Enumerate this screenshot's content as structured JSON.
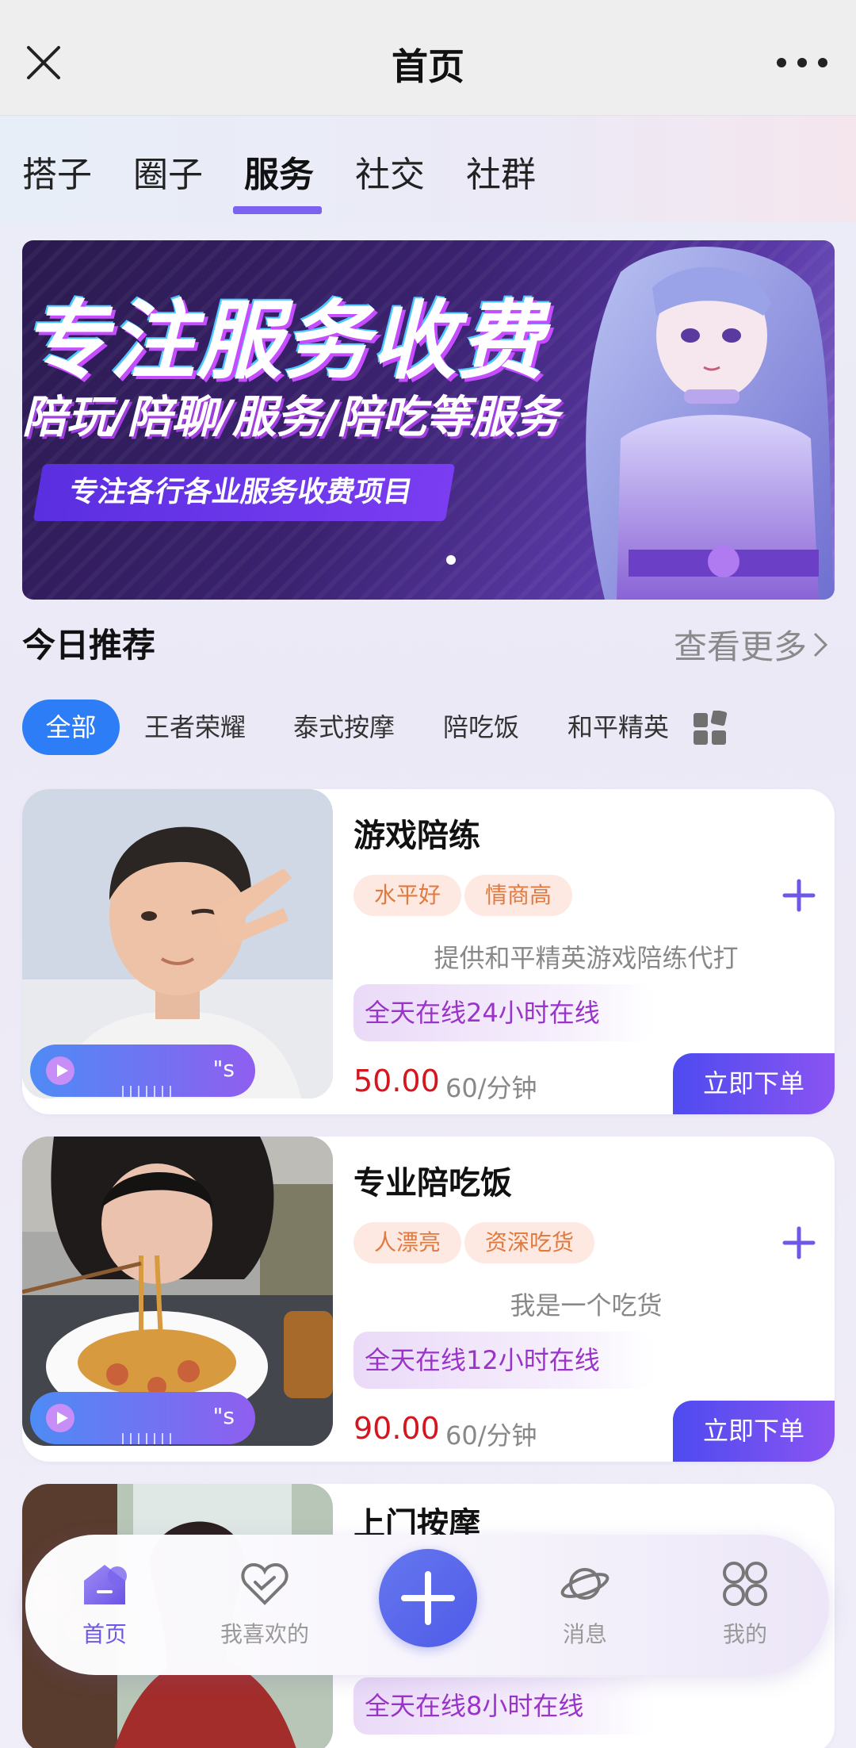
{
  "header": {
    "title": "首页",
    "close_icon": "close-icon",
    "more_icon": "more-dots-icon"
  },
  "tabs": [
    {
      "label": "搭子"
    },
    {
      "label": "圈子"
    },
    {
      "label": "服务",
      "active": true
    },
    {
      "label": "社交"
    },
    {
      "label": "社群"
    }
  ],
  "banner": {
    "headline": "专注服务收费",
    "subline": "陪玩/陪聊/服务/陪吃等服务",
    "tag": "专注各行各业服务收费项目",
    "slide_count": 1
  },
  "section": {
    "title": "今日推荐",
    "see_more": "查看更多"
  },
  "chips": [
    "全部",
    "王者荣耀",
    "泰式按摩",
    "陪吃饭",
    "和平精英"
  ],
  "active_chip": "全部",
  "cards": [
    {
      "title": "游戏陪练",
      "tags": [
        "水平好",
        "情商高"
      ],
      "description": "提供和平精英游戏陪练代打",
      "online": "全天在线24小时在线",
      "price": "50.00",
      "unit": "60/分钟",
      "order_label": "立即下单",
      "audio_label": "\"s"
    },
    {
      "title": "专业陪吃饭",
      "tags": [
        "人漂亮",
        "资深吃货"
      ],
      "description": "我是一个吃货",
      "online": "全天在线12小时在线",
      "price": "90.00",
      "unit": "60/分钟",
      "order_label": "立即下单",
      "audio_label": "\"s"
    },
    {
      "title": "上门按摩",
      "online": "全天在线8小时在线"
    }
  ],
  "bottom_nav": [
    {
      "label": "首页",
      "icon": "home-icon",
      "active": true
    },
    {
      "label": "我喜欢的",
      "icon": "heart-icon"
    },
    {
      "label": "",
      "icon": "plus-icon"
    },
    {
      "label": "消息",
      "icon": "planet-icon"
    },
    {
      "label": "我的",
      "icon": "grid-icon"
    }
  ],
  "colors": {
    "accent": "#7b63f0",
    "chip_active": "#2d7df6",
    "price": "#d4161f",
    "tag_text": "#e07a3f",
    "tag_bg": "#fde9e1",
    "online_text": "#9a34c9"
  }
}
